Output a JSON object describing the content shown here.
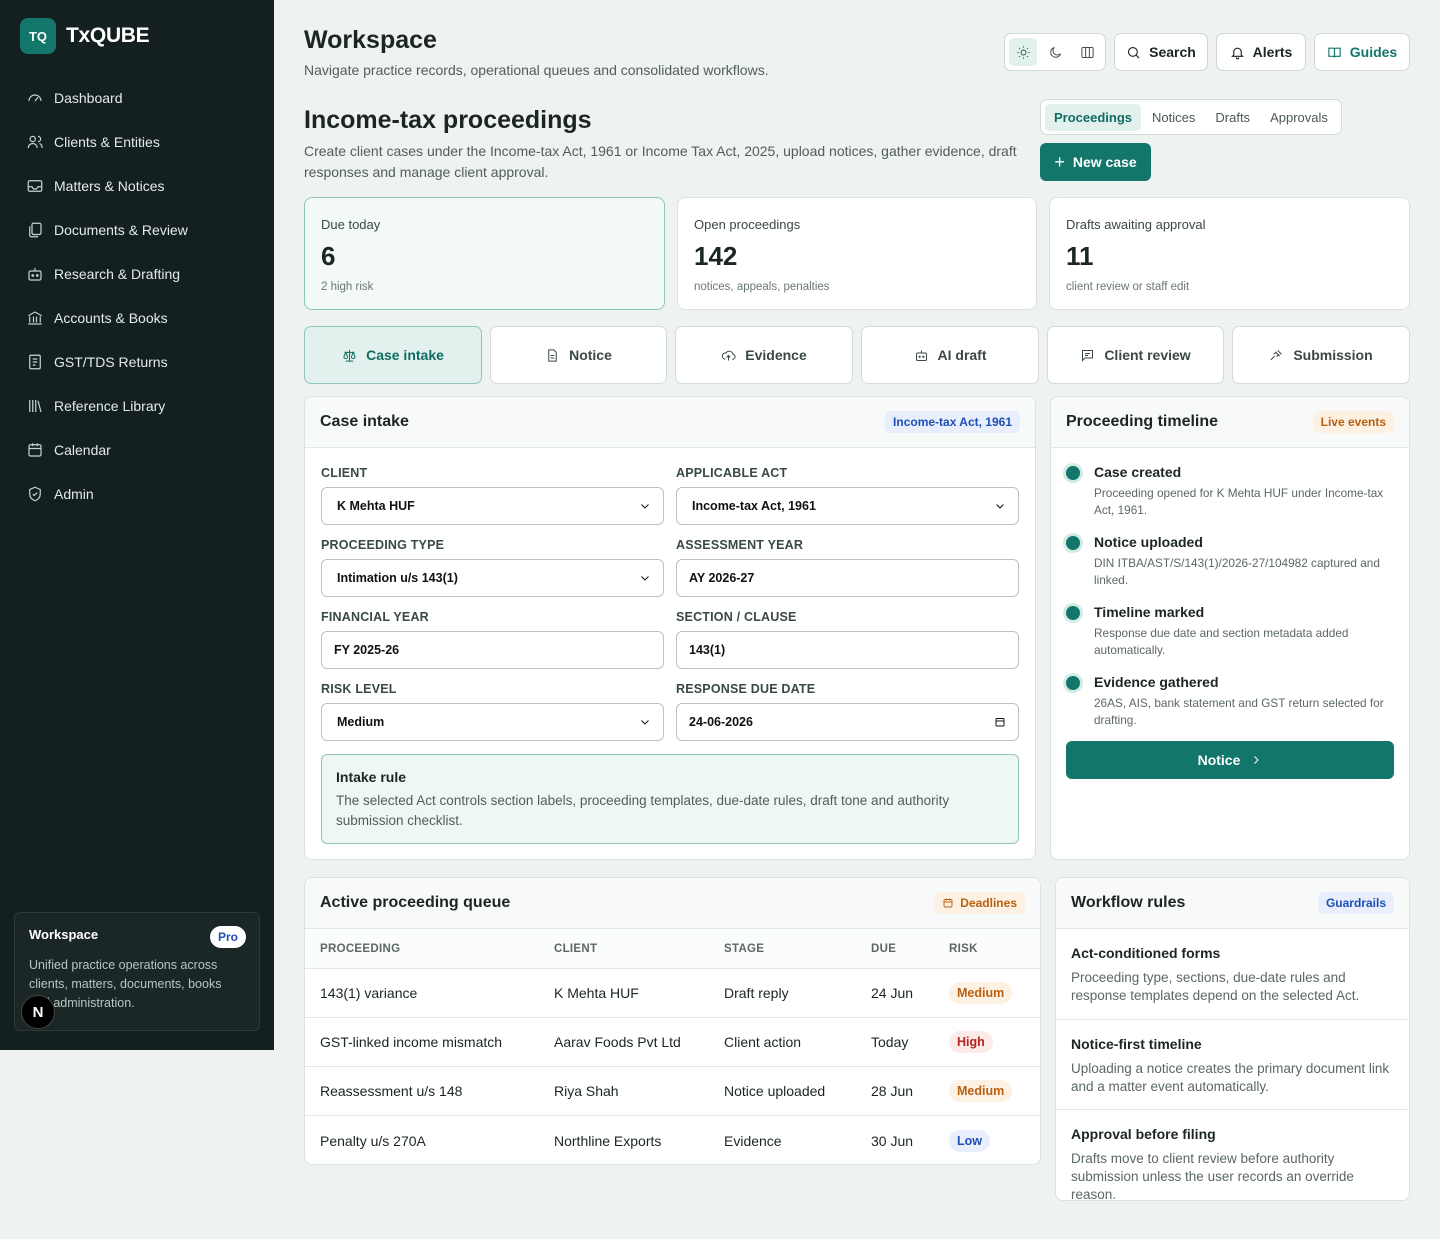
{
  "brand": {
    "logo": "TQ",
    "name": "TxQUBE"
  },
  "sidebar": {
    "items": [
      {
        "label": "Dashboard",
        "icon": "gauge-icon"
      },
      {
        "label": "Clients & Entities",
        "icon": "users-icon"
      },
      {
        "label": "Matters & Notices",
        "icon": "inbox-icon"
      },
      {
        "label": "Documents & Review",
        "icon": "files-icon"
      },
      {
        "label": "Research & Drafting",
        "icon": "bot-icon"
      },
      {
        "label": "Accounts & Books",
        "icon": "bank-icon"
      },
      {
        "label": "GST/TDS Returns",
        "icon": "receipt-icon"
      },
      {
        "label": "Reference Library",
        "icon": "library-icon"
      },
      {
        "label": "Calendar",
        "icon": "calendar-icon"
      },
      {
        "label": "Admin",
        "icon": "shield-icon"
      }
    ],
    "card": {
      "title": "Workspace",
      "badge": "Pro",
      "text": "Unified practice operations across clients, matters, documents, books and administration."
    },
    "n_badge": "N"
  },
  "header": {
    "title": "Workspace",
    "subtitle": "Navigate practice records, operational queues and consolidated workflows.",
    "search": "Search",
    "alerts": "Alerts",
    "guides": "Guides"
  },
  "section": {
    "title": "Income-tax proceedings",
    "subtitle": "Create client cases under the Income-tax Act, 1961 or Income Tax Act, 2025, upload notices, gather evidence, draft responses and manage client approval.",
    "tabs": [
      "Proceedings",
      "Notices",
      "Drafts",
      "Approvals"
    ],
    "new_case": "New case"
  },
  "stats": [
    {
      "label": "Due today",
      "value": "6",
      "note": "2 high risk"
    },
    {
      "label": "Open proceedings",
      "value": "142",
      "note": "notices, appeals, penalties"
    },
    {
      "label": "Drafts awaiting approval",
      "value": "11",
      "note": "client review or staff edit"
    }
  ],
  "steps": [
    "Case intake",
    "Notice",
    "Evidence",
    "AI draft",
    "Client review",
    "Submission"
  ],
  "intake": {
    "title": "Case intake",
    "tag": "Income-tax Act, 1961",
    "fields": {
      "client": {
        "label": "CLIENT",
        "value": "K Mehta HUF"
      },
      "act": {
        "label": "APPLICABLE ACT",
        "value": "Income-tax Act, 1961"
      },
      "ptype": {
        "label": "PROCEEDING TYPE",
        "value": "Intimation u/s 143(1)"
      },
      "ay": {
        "label": "ASSESSMENT YEAR",
        "value": "AY 2026-27"
      },
      "fy": {
        "label": "FINANCIAL YEAR",
        "value": "FY 2025-26"
      },
      "section": {
        "label": "SECTION / CLAUSE",
        "value": "143(1)"
      },
      "risk": {
        "label": "RISK LEVEL",
        "value": "Medium"
      },
      "due": {
        "label": "RESPONSE DUE DATE",
        "value": "24-06-2026"
      }
    },
    "rule": {
      "title": "Intake rule",
      "text": "The selected Act controls section labels, proceeding templates, due-date rules, draft tone and authority submission checklist."
    }
  },
  "timeline": {
    "title": "Proceeding timeline",
    "tag": "Live events",
    "events": [
      {
        "title": "Case created",
        "text": "Proceeding opened for K Mehta HUF under Income-tax Act, 1961."
      },
      {
        "title": "Notice uploaded",
        "text": "DIN ITBA/AST/S/143(1)/2026-27/104982 captured and linked."
      },
      {
        "title": "Timeline marked",
        "text": "Response due date and section metadata added automatically."
      },
      {
        "title": "Evidence gathered",
        "text": "26AS, AIS, bank statement and GST return selected for drafting."
      }
    ],
    "button": "Notice"
  },
  "queue": {
    "title": "Active proceeding queue",
    "tag": "Deadlines",
    "columns": [
      "PROCEEDING",
      "CLIENT",
      "STAGE",
      "DUE",
      "RISK"
    ],
    "rows": [
      {
        "proceeding": "143(1) variance",
        "client": "K Mehta HUF",
        "stage": "Draft reply",
        "due": "24 Jun",
        "risk": "Medium"
      },
      {
        "proceeding": "GST-linked income mismatch",
        "client": "Aarav Foods Pvt Ltd",
        "stage": "Client action",
        "due": "Today",
        "risk": "High"
      },
      {
        "proceeding": "Reassessment u/s 148",
        "client": "Riya Shah",
        "stage": "Notice uploaded",
        "due": "28 Jun",
        "risk": "Medium"
      },
      {
        "proceeding": "Penalty u/s 270A",
        "client": "Northline Exports",
        "stage": "Evidence",
        "due": "30 Jun",
        "risk": "Low"
      }
    ]
  },
  "workflow": {
    "title": "Workflow rules",
    "tag": "Guardrails",
    "items": [
      {
        "title": "Act-conditioned forms",
        "text": "Proceeding type, sections, due-date rules and response templates depend on the selected Act."
      },
      {
        "title": "Notice-first timeline",
        "text": "Uploading a notice creates the primary document link and a matter event automatically."
      },
      {
        "title": "Approval before filing",
        "text": "Drafts move to client review before authority submission unless the user records an override reason."
      }
    ]
  },
  "colors": {
    "accent": "#12766b",
    "sidebar": "#14201f",
    "background": "#eef2f1"
  }
}
